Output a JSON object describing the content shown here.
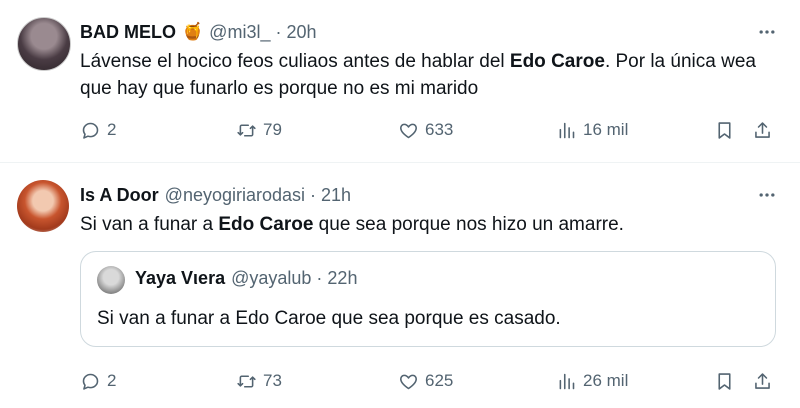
{
  "tweets": [
    {
      "name": "BAD MELO",
      "emoji": "🍯",
      "handle": "@mi3l_",
      "time": "20h",
      "text_parts": [
        "Lávense el hocico feos culiaos antes de hablar del ",
        "Edo Caroe",
        ". Por la única wea que hay que funarlo es porque no es mi marido"
      ],
      "replies": "2",
      "retweets": "79",
      "likes": "633",
      "views": "16 mil"
    },
    {
      "name": "Is A Door",
      "handle": "@neyogiriarodasi",
      "time": "21h",
      "text_parts": [
        "Si van a funar a ",
        "Edo Caroe",
        " que sea porque nos hizo un amarre."
      ],
      "quote": {
        "name": "Yaya Vιera",
        "handle": "@yayalub",
        "time": "22h",
        "text": "Si van a funar a Edo Caroe que sea porque es casado."
      },
      "replies": "2",
      "retweets": "73",
      "likes": "625",
      "views": "26 mil"
    }
  ],
  "separator": "·",
  "icons": [
    "more-icon",
    "reply-icon",
    "retweet-icon",
    "like-icon",
    "views-icon",
    "bookmark-icon",
    "share-icon"
  ]
}
